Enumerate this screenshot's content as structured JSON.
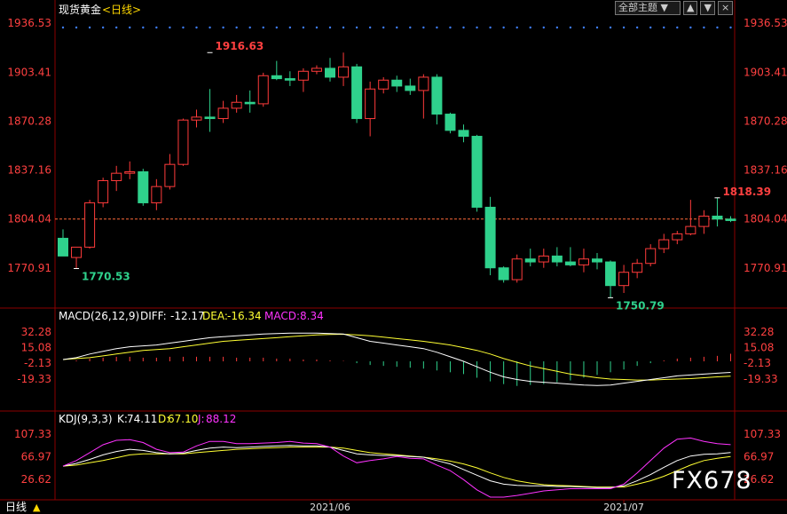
{
  "header": {
    "symbol": "现货黄金",
    "period": "<日线>",
    "topic_select": "全部主题",
    "btn_up": "▲",
    "btn_down": "▼",
    "btn_close": "×"
  },
  "colors": {
    "up": "#ff3b3b",
    "down": "#2fd18c",
    "grid": "#8b0000",
    "price_axis": "#ff4040",
    "k_line": "#ffffff",
    "d_line": "#ffff33",
    "j_line": "#ff33ff",
    "diff_line": "#ffffff",
    "dea_line": "#ffff33"
  },
  "chart_data": [
    {
      "type": "candlestick",
      "title": "现货黄金 <日线>",
      "y_ticks": [
        "1936.53",
        "1903.41",
        "1870.28",
        "1837.16",
        "1804.04",
        "1770.91"
      ],
      "ylim": [
        1745,
        1939
      ],
      "current_price": 1804.04,
      "annotations": [
        {
          "text": "1916.63",
          "index": 11,
          "value": 1916.63
        },
        {
          "text": "1770.53",
          "index": 1,
          "value": 1770.53
        },
        {
          "text": "1750.79",
          "index": 41,
          "value": 1750.79
        },
        {
          "text": "1818.39",
          "index": 49,
          "value": 1818.39
        }
      ],
      "x_ticks": [
        {
          "index": 20,
          "label": "2021/06"
        },
        {
          "index": 42,
          "label": "2021/07"
        }
      ],
      "candles": [
        {
          "o": 1791,
          "h": 1797,
          "l": 1780,
          "c": 1779
        },
        {
          "o": 1778,
          "h": 1783,
          "l": 1770.53,
          "c": 1785
        },
        {
          "o": 1785,
          "h": 1817,
          "l": 1784,
          "c": 1815
        },
        {
          "o": 1815,
          "h": 1832,
          "l": 1812,
          "c": 1830
        },
        {
          "o": 1830,
          "h": 1840,
          "l": 1823,
          "c": 1835
        },
        {
          "o": 1835,
          "h": 1843,
          "l": 1831,
          "c": 1836
        },
        {
          "o": 1836,
          "h": 1838,
          "l": 1813,
          "c": 1815
        },
        {
          "o": 1815,
          "h": 1831,
          "l": 1810,
          "c": 1826
        },
        {
          "o": 1826,
          "h": 1848,
          "l": 1824,
          "c": 1841
        },
        {
          "o": 1841,
          "h": 1872,
          "l": 1840,
          "c": 1871
        },
        {
          "o": 1871,
          "h": 1878,
          "l": 1866,
          "c": 1873
        },
        {
          "o": 1873,
          "h": 1892,
          "l": 1863,
          "c": 1872
        },
        {
          "o": 1872,
          "h": 1884,
          "l": 1869,
          "c": 1879
        },
        {
          "o": 1879,
          "h": 1888,
          "l": 1876,
          "c": 1883
        },
        {
          "o": 1883,
          "h": 1891,
          "l": 1876,
          "c": 1882
        },
        {
          "o": 1882,
          "h": 1903,
          "l": 1880,
          "c": 1901
        },
        {
          "o": 1901,
          "h": 1911,
          "l": 1898,
          "c": 1899
        },
        {
          "o": 1899,
          "h": 1904,
          "l": 1894,
          "c": 1898
        },
        {
          "o": 1898,
          "h": 1906,
          "l": 1890,
          "c": 1904
        },
        {
          "o": 1904,
          "h": 1908,
          "l": 1902,
          "c": 1906
        },
        {
          "o": 1906,
          "h": 1913,
          "l": 1897,
          "c": 1900
        },
        {
          "o": 1900,
          "h": 1916.63,
          "l": 1894,
          "c": 1907
        },
        {
          "o": 1907,
          "h": 1909,
          "l": 1869,
          "c": 1872
        },
        {
          "o": 1872,
          "h": 1897,
          "l": 1860,
          "c": 1892
        },
        {
          "o": 1892,
          "h": 1900,
          "l": 1889,
          "c": 1898
        },
        {
          "o": 1898,
          "h": 1901,
          "l": 1890,
          "c": 1894
        },
        {
          "o": 1894,
          "h": 1899,
          "l": 1888,
          "c": 1891
        },
        {
          "o": 1891,
          "h": 1902,
          "l": 1872,
          "c": 1900
        },
        {
          "o": 1900,
          "h": 1902,
          "l": 1868,
          "c": 1875
        },
        {
          "o": 1875,
          "h": 1876,
          "l": 1862,
          "c": 1864
        },
        {
          "o": 1864,
          "h": 1868,
          "l": 1856,
          "c": 1860
        },
        {
          "o": 1860,
          "h": 1861,
          "l": 1809,
          "c": 1812
        },
        {
          "o": 1812,
          "h": 1819,
          "l": 1766,
          "c": 1771
        },
        {
          "o": 1771,
          "h": 1772,
          "l": 1761,
          "c": 1763
        },
        {
          "o": 1763,
          "h": 1780,
          "l": 1761,
          "c": 1777
        },
        {
          "o": 1777,
          "h": 1784,
          "l": 1772,
          "c": 1775
        },
        {
          "o": 1775,
          "h": 1784,
          "l": 1771,
          "c": 1779
        },
        {
          "o": 1779,
          "h": 1785,
          "l": 1772,
          "c": 1775
        },
        {
          "o": 1775,
          "h": 1785,
          "l": 1772,
          "c": 1773
        },
        {
          "o": 1773,
          "h": 1784,
          "l": 1768,
          "c": 1777
        },
        {
          "o": 1777,
          "h": 1781,
          "l": 1770,
          "c": 1775
        },
        {
          "o": 1775,
          "h": 1776,
          "l": 1750.79,
          "c": 1759
        },
        {
          "o": 1759,
          "h": 1773,
          "l": 1754,
          "c": 1768
        },
        {
          "o": 1768,
          "h": 1777,
          "l": 1764,
          "c": 1774
        },
        {
          "o": 1774,
          "h": 1787,
          "l": 1772,
          "c": 1784
        },
        {
          "o": 1784,
          "h": 1794,
          "l": 1781,
          "c": 1790
        },
        {
          "o": 1790,
          "h": 1796,
          "l": 1787,
          "c": 1794
        },
        {
          "o": 1794,
          "h": 1817,
          "l": 1793,
          "c": 1799
        },
        {
          "o": 1799,
          "h": 1810,
          "l": 1794,
          "c": 1806
        },
        {
          "o": 1806,
          "h": 1818.39,
          "l": 1799,
          "c": 1804
        },
        {
          "o": 1804,
          "h": 1806,
          "l": 1802,
          "c": 1803
        }
      ]
    },
    {
      "type": "line",
      "title": "MACD(26,12,9)",
      "legend": [
        {
          "label": "DIFF:",
          "value": "-12.17"
        },
        {
          "label": "DEA:",
          "value": "-16.34"
        },
        {
          "label": "MACD:",
          "value": "8.34"
        }
      ],
      "y_ticks": [
        "32.28",
        "15.08",
        "-2.13",
        "-19.33"
      ],
      "ylim": [
        -38,
        40
      ],
      "diff": [
        2,
        4,
        8,
        11,
        14,
        16,
        17,
        18,
        20,
        22,
        24,
        26,
        27,
        28,
        29,
        30,
        30.5,
        31,
        31,
        31,
        30.5,
        30,
        26,
        22,
        20,
        18,
        16,
        14,
        10,
        5,
        0,
        -6,
        -12,
        -17,
        -20,
        -22,
        -23,
        -24,
        -25,
        -26,
        -26.5,
        -26,
        -24,
        -22,
        -20,
        -18,
        -16,
        -15,
        -14,
        -13,
        -12.17
      ],
      "dea": [
        2,
        3,
        4,
        6,
        8,
        10,
        12,
        13,
        14,
        16,
        18,
        20,
        22,
        23,
        24,
        25,
        26,
        27,
        28,
        29,
        29.5,
        29.8,
        29,
        28,
        26.5,
        25,
        23.5,
        22,
        20,
        18,
        15,
        12,
        8,
        3,
        -1,
        -5,
        -8,
        -11,
        -14,
        -16,
        -18,
        -19.5,
        -20,
        -20.5,
        -20.5,
        -20,
        -19.5,
        -19,
        -18,
        -17,
        -16.34
      ],
      "macd": [
        0,
        1,
        3,
        4,
        5,
        5,
        4,
        4,
        5,
        5,
        5,
        5,
        5,
        4,
        4,
        4,
        3,
        3,
        2,
        2,
        1,
        0.5,
        -2,
        -4,
        -5,
        -6,
        -7,
        -8,
        -10,
        -12,
        -14,
        -18,
        -22,
        -25,
        -27,
        -26,
        -25,
        -23,
        -21,
        -18,
        -15,
        -12,
        -9,
        -5,
        -2,
        1,
        3,
        4,
        5,
        6,
        8.34
      ]
    },
    {
      "type": "line",
      "title": "KDJ(9,3,3)",
      "legend": [
        {
          "label": "K:",
          "value": "74.11"
        },
        {
          "label": "D:",
          "value": "67.10"
        },
        {
          "label": "J:",
          "value": "88.12"
        }
      ],
      "y_ticks": [
        "107.33",
        "66.97",
        "26.62"
      ],
      "ylim": [
        -5,
        118
      ],
      "k": [
        50,
        55,
        62,
        70,
        76,
        80,
        78,
        74,
        72,
        73,
        78,
        82,
        84,
        83,
        84,
        85,
        86,
        87,
        86,
        86,
        84,
        78,
        72,
        70,
        69,
        69,
        67,
        66,
        60,
        54,
        44,
        34,
        24,
        18,
        16,
        15,
        15,
        14,
        14,
        13,
        12,
        12,
        15,
        24,
        35,
        48,
        60,
        68,
        71,
        72,
        74.11
      ],
      "d": [
        50,
        52,
        56,
        60,
        65,
        70,
        72,
        72,
        72,
        72,
        74,
        76,
        78,
        80,
        81,
        82,
        83,
        84,
        84,
        84,
        84,
        82,
        78,
        74,
        72,
        70,
        68,
        66,
        63,
        59,
        54,
        47,
        38,
        30,
        24,
        20,
        17,
        16,
        15,
        14,
        13,
        13,
        13,
        18,
        24,
        32,
        42,
        52,
        60,
        64,
        67.1
      ],
      "j": [
        50,
        60,
        74,
        88,
        96,
        97,
        92,
        80,
        74,
        75,
        86,
        94,
        94,
        90,
        90,
        91,
        92,
        94,
        91,
        90,
        84,
        68,
        56,
        60,
        63,
        67,
        64,
        63,
        52,
        42,
        26,
        8,
        -5,
        -5,
        -2,
        2,
        6,
        8,
        10,
        10,
        10,
        10,
        18,
        38,
        60,
        82,
        98,
        100,
        94,
        90,
        88.12
      ]
    }
  ],
  "x_axis": {
    "label_left": "日线",
    "ticks": [
      "2021/06",
      "2021/07"
    ]
  },
  "watermark": "FX678"
}
